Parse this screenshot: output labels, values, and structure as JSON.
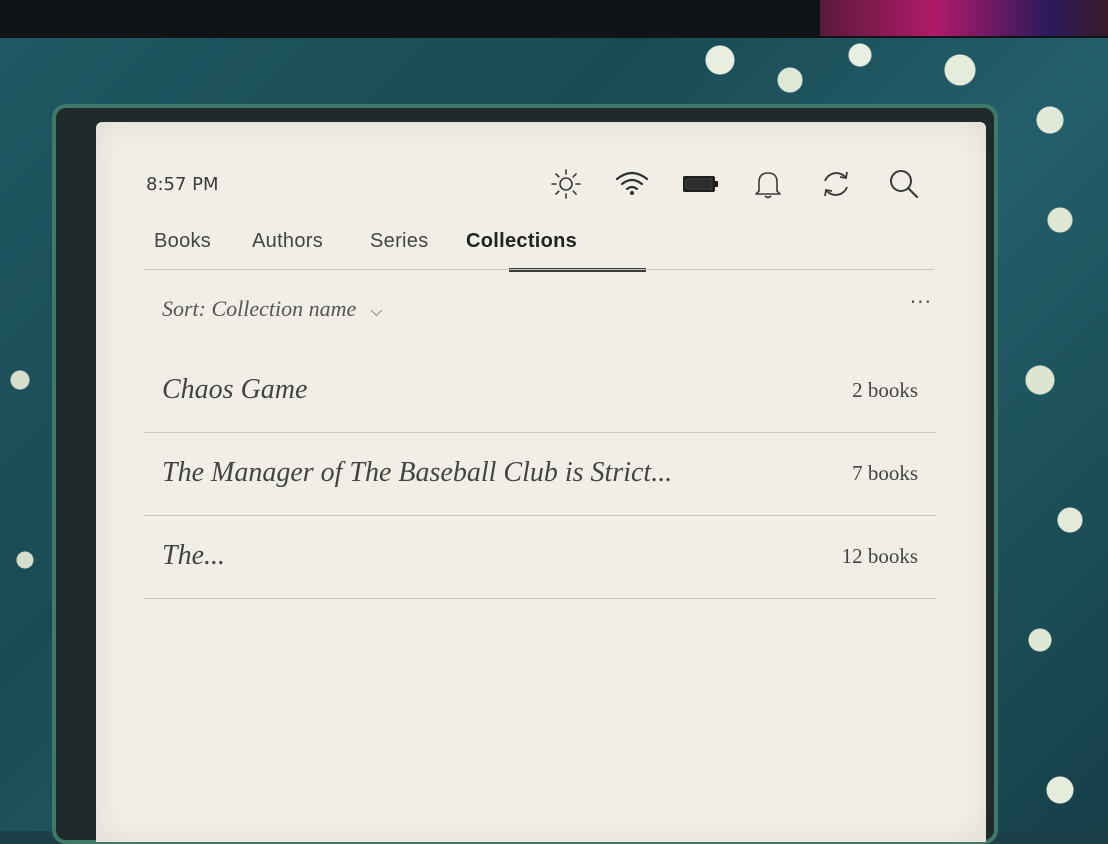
{
  "status_bar": {
    "time": "8:57 PM",
    "icons": [
      "brightness-icon",
      "wifi-icon",
      "battery-icon",
      "notifications-icon",
      "sync-icon",
      "search-icon"
    ]
  },
  "tabs": [
    {
      "label": "Books",
      "active": false
    },
    {
      "label": "Authors",
      "active": false
    },
    {
      "label": "Series",
      "active": false
    },
    {
      "label": "Collections",
      "active": true
    }
  ],
  "sort": {
    "label": "Sort: Collection name"
  },
  "more_menu": "···",
  "collections": [
    {
      "name": "Chaos Game",
      "count": "2 books"
    },
    {
      "name": "The Manager of The Baseball Club is Strict...",
      "count": "7 books"
    },
    {
      "name": "The...",
      "count": "12 books"
    }
  ],
  "colors": {
    "screen": "#f1eee7",
    "text": "#444444",
    "divider": "#cdcac2",
    "bezel_trim": "#3e7a67"
  }
}
